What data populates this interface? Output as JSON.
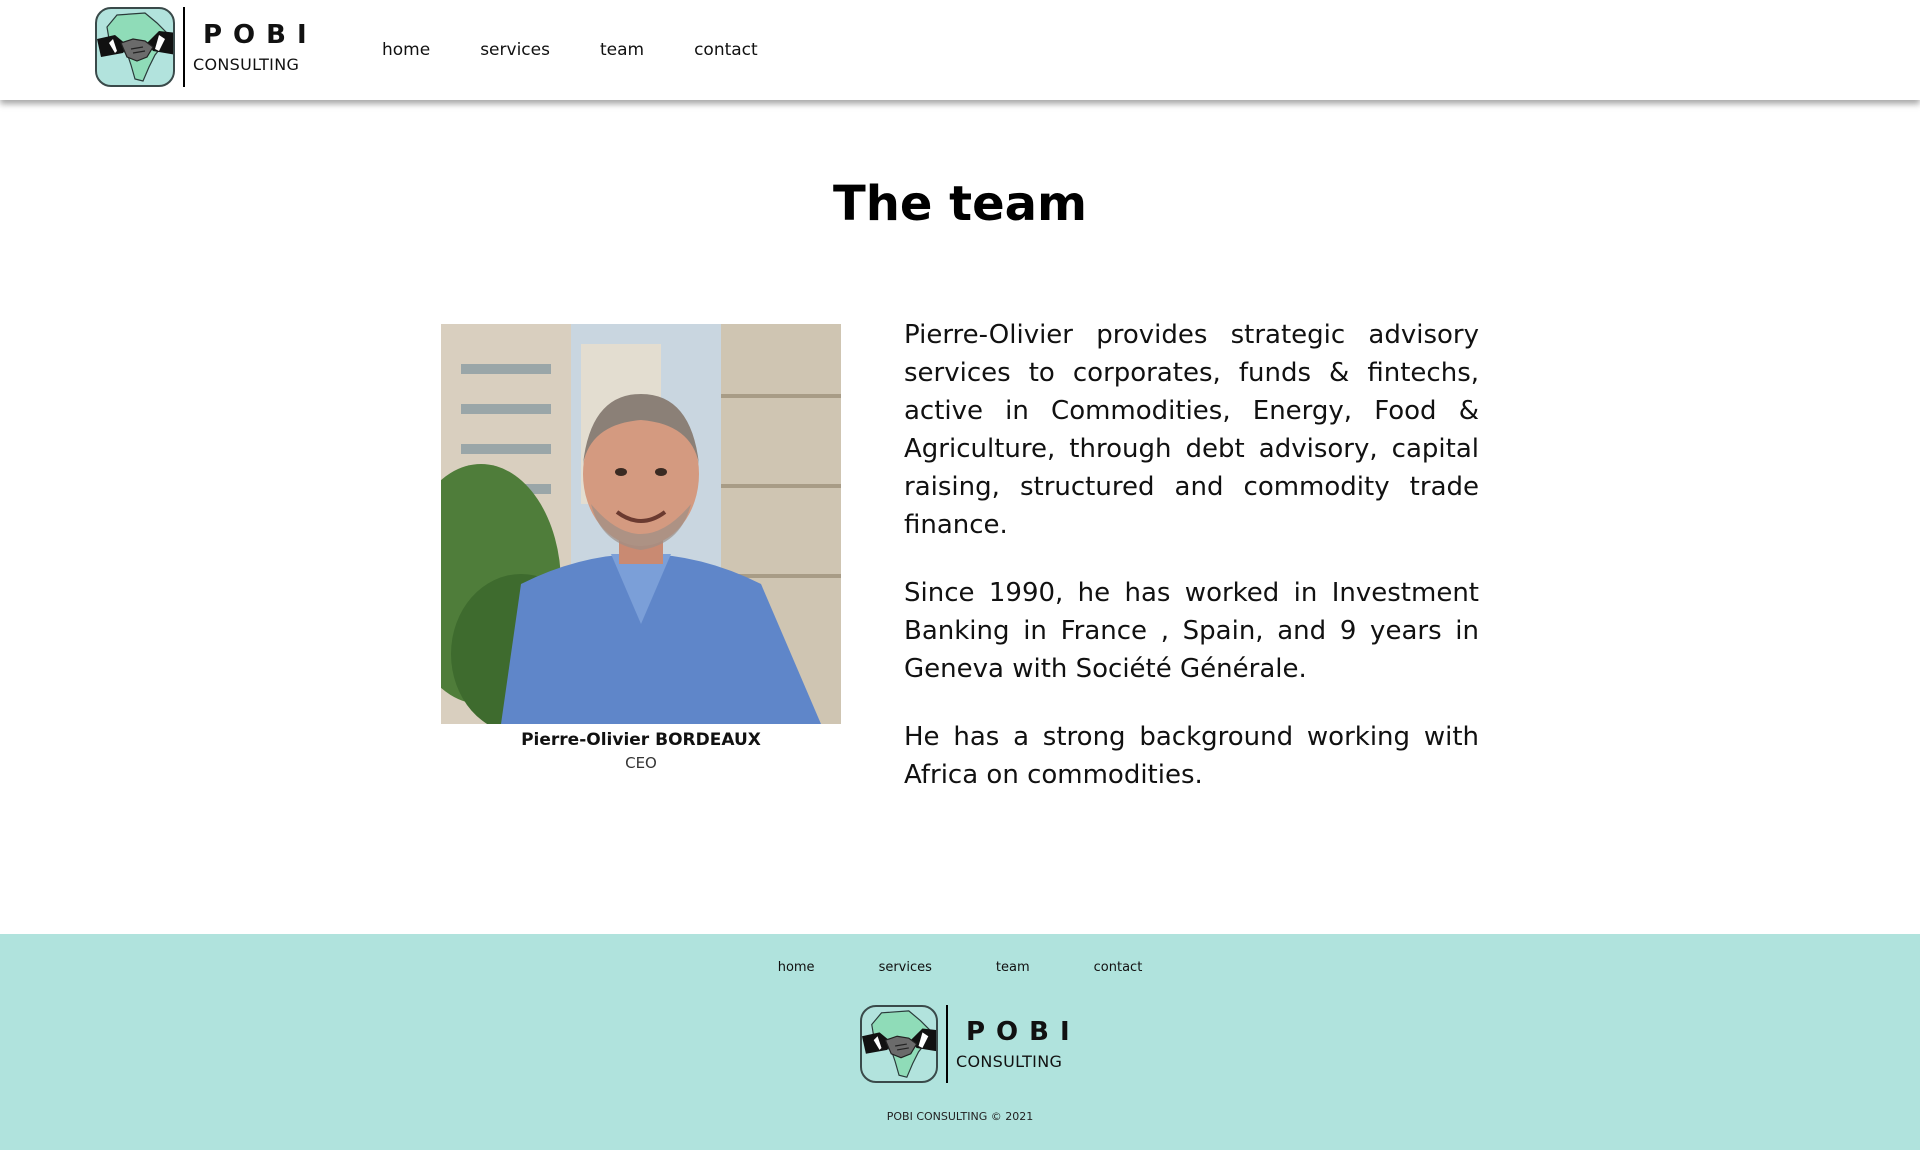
{
  "header": {
    "logo": {
      "title": "POBI",
      "subtitle": "CONSULTING",
      "icon": "handshake-africa-icon"
    },
    "nav": [
      "home",
      "services",
      "team",
      "contact"
    ]
  },
  "main": {
    "title": "The team",
    "member": {
      "name": "Pierre-Olivier BORDEAUX",
      "role": "CEO",
      "bio": [
        "Pierre-Olivier provides strategic advisory services to corporates, funds & fintechs, active in Commodities, Energy, Food & Agriculture, through debt advisory, capital raising, structured and commodity trade finance.",
        "Since 1990, he has worked in Investment Banking in France , Spain, and 9 years in Geneva with Société Générale.",
        "He has a strong background working with Africa on commodities."
      ]
    }
  },
  "footer": {
    "nav": [
      "home",
      "services",
      "team",
      "contact"
    ],
    "logo": {
      "title": "POBI",
      "subtitle": "CONSULTING",
      "icon": "handshake-africa-icon"
    },
    "copyright": "POBI CONSULTING © 2021"
  },
  "colors": {
    "footer_bg": "#b0e3dd",
    "logo_bg": "#b2e3dd",
    "africa_green": "#8fdcb8"
  }
}
